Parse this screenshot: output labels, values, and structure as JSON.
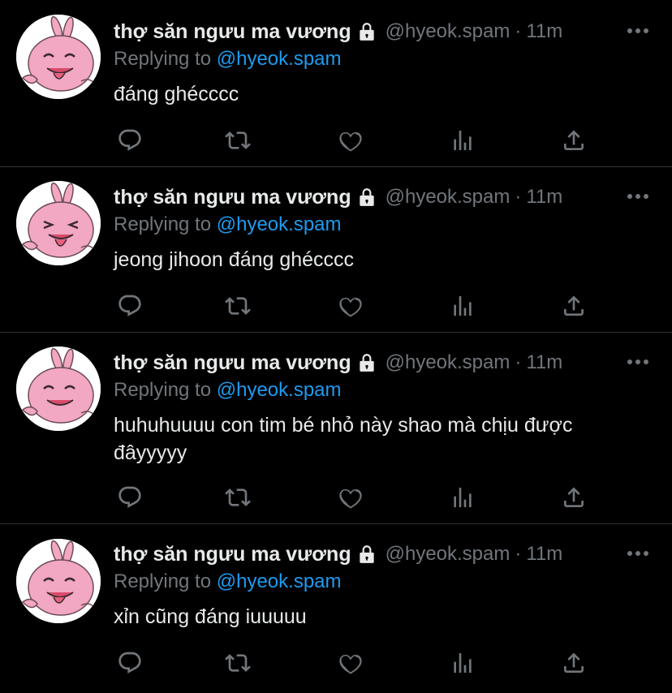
{
  "tweets": [
    {
      "display_name": "thợ săn ngưu ma vương",
      "handle": "@hyeok.spam",
      "separator": "·",
      "time": "11m",
      "replying_prefix": "Replying to",
      "replying_to": "@hyeok.spam",
      "text": "đáng ghécccc"
    },
    {
      "display_name": "thợ săn ngưu ma vương",
      "handle": "@hyeok.spam",
      "separator": "·",
      "time": "11m",
      "replying_prefix": "Replying to",
      "replying_to": "@hyeok.spam",
      "text": "jeong jihoon đáng ghécccc"
    },
    {
      "display_name": "thợ săn ngưu ma vương",
      "handle": "@hyeok.spam",
      "separator": "·",
      "time": "11m",
      "replying_prefix": "Replying to",
      "replying_to": "@hyeok.spam",
      "text": "huhuhuuuu con tim bé nhỏ này shao mà chịu được đâyyyyy"
    },
    {
      "display_name": "thợ săn ngưu ma vương",
      "handle": "@hyeok.spam",
      "separator": "·",
      "time": "11m",
      "replying_prefix": "Replying to",
      "replying_to": "@hyeok.spam",
      "text": "xỉn cũng đáng iuuuuu"
    }
  ],
  "icons": {
    "protected": "lock-icon",
    "more": "more-icon",
    "reply": "reply-icon",
    "retweet": "retweet-icon",
    "like": "like-icon",
    "analytics": "analytics-icon",
    "share": "share-icon"
  },
  "colors": {
    "background": "#000000",
    "primary_text": "#e7e9ea",
    "secondary_text": "#71767b",
    "mention": "#1d9bf0",
    "divider": "#2f3336",
    "avatar_pink": "#f2a7c3"
  }
}
